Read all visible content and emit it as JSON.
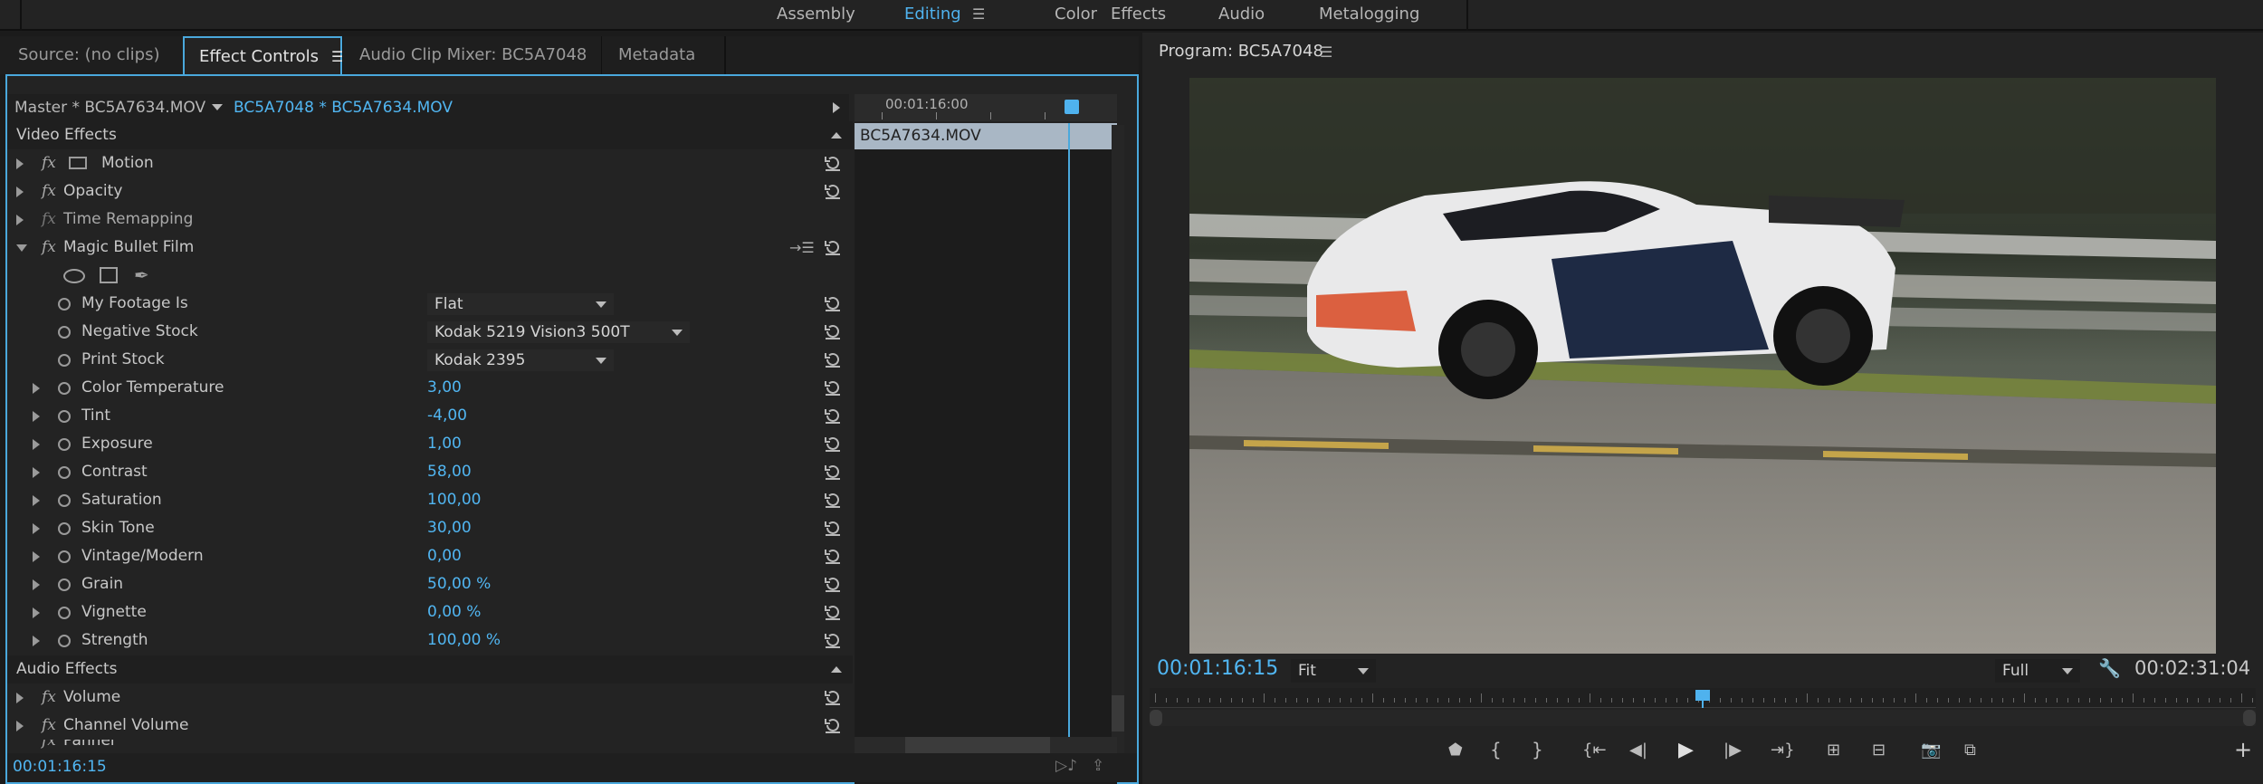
{
  "workspaces": [
    {
      "label": "Assembly",
      "active": false
    },
    {
      "label": "Editing",
      "active": true
    },
    {
      "label": "Color",
      "active": false
    },
    {
      "label": "Effects",
      "active": false
    },
    {
      "label": "Audio",
      "active": false
    },
    {
      "label": "Metalogging",
      "active": false
    }
  ],
  "left_tabs": {
    "source": "Source: (no clips)",
    "effect_controls": "Effect Controls",
    "audio_mixer": "Audio Clip Mixer: BC5A7048",
    "metadata": "Metadata"
  },
  "effect_controls": {
    "master_label": "Master * BC5A7634.MOV",
    "sequence_label": "BC5A7048 * BC5A7634.MOV",
    "mini_timecode": "00:01:16:00",
    "clip_name": "BC5A7634.MOV",
    "video_section": "Video Effects",
    "audio_section": "Audio Effects",
    "motion": "Motion",
    "opacity": "Opacity",
    "time_remapping": "Time Remapping",
    "magic_bullet": "Magic Bullet Film",
    "params": [
      {
        "label": "My Footage Is",
        "type": "dropdown",
        "value": "Flat"
      },
      {
        "label": "Negative Stock",
        "type": "dropdown",
        "value": "Kodak 5219 Vision3 500T"
      },
      {
        "label": "Print Stock",
        "type": "dropdown",
        "value": "Kodak 2395"
      },
      {
        "label": "Color Temperature",
        "type": "value",
        "value": "3,00"
      },
      {
        "label": "Tint",
        "type": "value",
        "value": "-4,00"
      },
      {
        "label": "Exposure",
        "type": "value",
        "value": "1,00"
      },
      {
        "label": "Contrast",
        "type": "value",
        "value": "58,00"
      },
      {
        "label": "Saturation",
        "type": "value",
        "value": "100,00"
      },
      {
        "label": "Skin Tone",
        "type": "value",
        "value": "30,00"
      },
      {
        "label": "Vintage/Modern",
        "type": "value",
        "value": "0,00"
      },
      {
        "label": "Grain",
        "type": "value",
        "value": "50,00 %"
      },
      {
        "label": "Vignette",
        "type": "value",
        "value": "0,00 %"
      },
      {
        "label": "Strength",
        "type": "value",
        "value": "100,00 %"
      }
    ],
    "volume": "Volume",
    "channel_volume": "Channel Volume",
    "panner": "Panner",
    "timecode": "00:01:16:15"
  },
  "program": {
    "title": "Program: BC5A7048",
    "timecode": "00:01:16:15",
    "fit": "Fit",
    "quality": "Full",
    "duration": "00:02:31:04",
    "playhead_fraction": 0.5
  },
  "icons": [
    "menu-icon",
    "reset-icon",
    "stopwatch-icon",
    "ellipse-mask-icon",
    "rect-mask-icon",
    "pen-mask-icon",
    "wrench-icon",
    "marker-icon",
    "in-point-icon",
    "out-point-icon",
    "go-to-in-icon",
    "step-back-icon",
    "play-icon",
    "step-forward-icon",
    "go-to-out-icon",
    "lift-icon",
    "extract-icon",
    "camera-icon",
    "comparison-icon",
    "add-icon"
  ]
}
